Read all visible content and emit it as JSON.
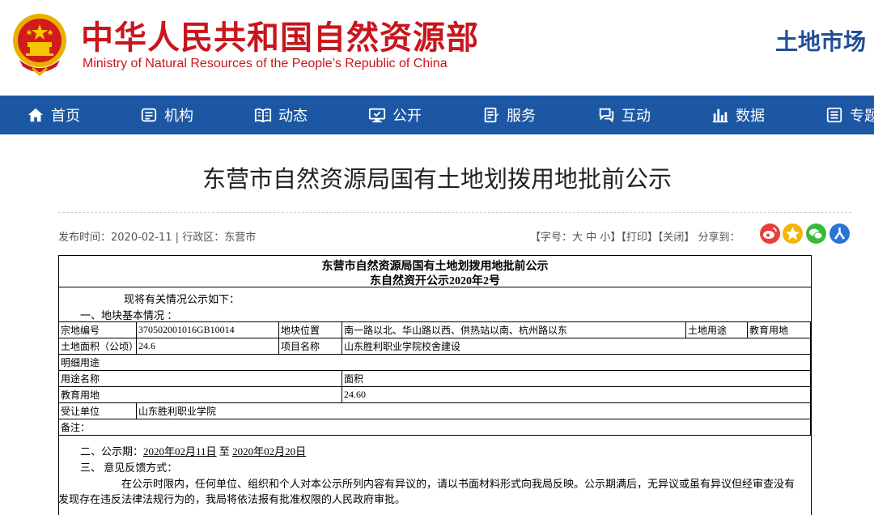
{
  "header": {
    "title_cn": "中华人民共和国自然资源部",
    "title_en": "Ministry of Natural Resources of the People’s Republic of China",
    "section": "土地市场",
    "brand_red": "#c8161d",
    "brand_blue": "#1c57a3"
  },
  "nav": [
    {
      "label": "首页",
      "icon": "home-icon"
    },
    {
      "label": "机构",
      "icon": "org-icon"
    },
    {
      "label": "动态",
      "icon": "news-icon"
    },
    {
      "label": "公开",
      "icon": "monitor-icon"
    },
    {
      "label": "服务",
      "icon": "service-icon"
    },
    {
      "label": "互动",
      "icon": "chat-icon"
    },
    {
      "label": "数据",
      "icon": "chart-icon"
    },
    {
      "label": "专题",
      "icon": "topic-icon"
    }
  ],
  "article": {
    "title": "东营市自然资源局国有土地划拨用地批前公示",
    "meta": "发布时间：2020-02-11  |  行政区：东营市",
    "font_size_label": "【字号：",
    "font_large": "大",
    "font_medium": "中",
    "font_small": "小",
    "font_size_close": "】",
    "print": "【打印】",
    "close": "【关闭】",
    "share_label": "分享到："
  },
  "document": {
    "heading": "东营市自然资源局国有土地划拨用地批前公示",
    "number": "东自然资开公示2020年2号",
    "intro": "现将有关情况公示如下：",
    "section1": "一、地块基本情况 ：",
    "table": {
      "row1": [
        "宗地编号",
        "370502001016GB10014",
        "地块位置",
        "南一路以北、华山路以西、供热站以南、杭州路以东",
        "土地用途",
        "教育用地"
      ],
      "row2": [
        "土地面积（公顷）",
        "24.6",
        "项目名称",
        "山东胜利职业学院校舍建设"
      ],
      "row3": [
        "明细用途"
      ],
      "row4": [
        "用途名称",
        "面积"
      ],
      "row5": [
        "教育用地",
        "24.60"
      ],
      "row6": [
        "受让单位",
        "山东胜利职业学院"
      ],
      "row7": [
        "备注："
      ]
    },
    "section2_label": "二、公示期：",
    "period_start": "2020年02月11日",
    "period_to": "至",
    "period_end": "2020年02月20日",
    "section3": "三、  意见反馈方式：",
    "para1": "在公示时限内，任何单位、组织和个人对本公示所列内容有异议的，请以书面材料形式向我局反映。公示期满后，无异议或虽有异议但经审查没有",
    "para2": "发现存在违反法律法规行为的，我局将依法报有批准权限的人民政府审批。"
  }
}
